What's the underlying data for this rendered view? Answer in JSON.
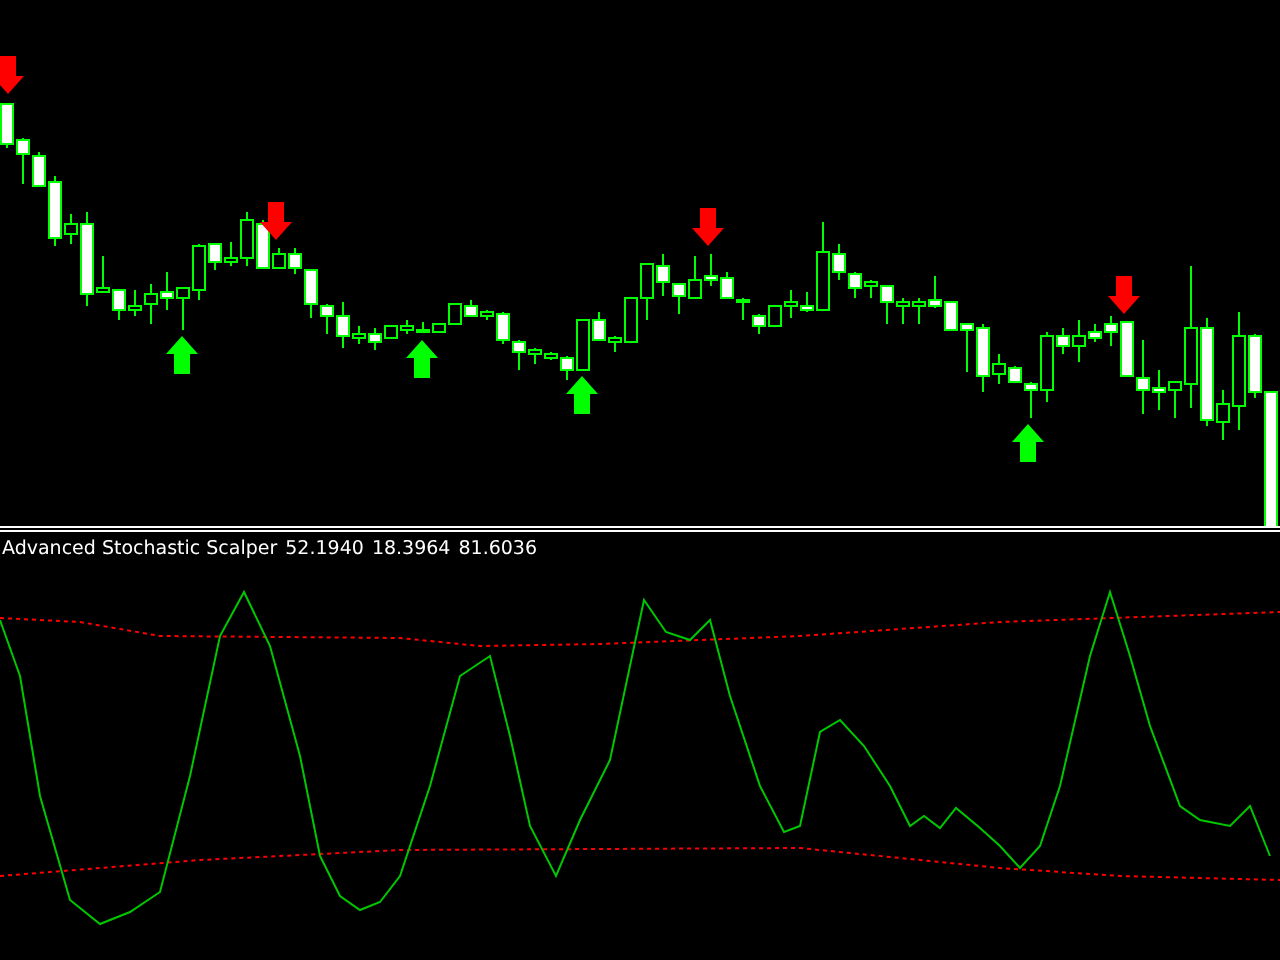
{
  "indicator": {
    "name": "Advanced Stochastic Scalper",
    "values": [
      "52.1940",
      "18.3964",
      "81.6036"
    ]
  }
}
